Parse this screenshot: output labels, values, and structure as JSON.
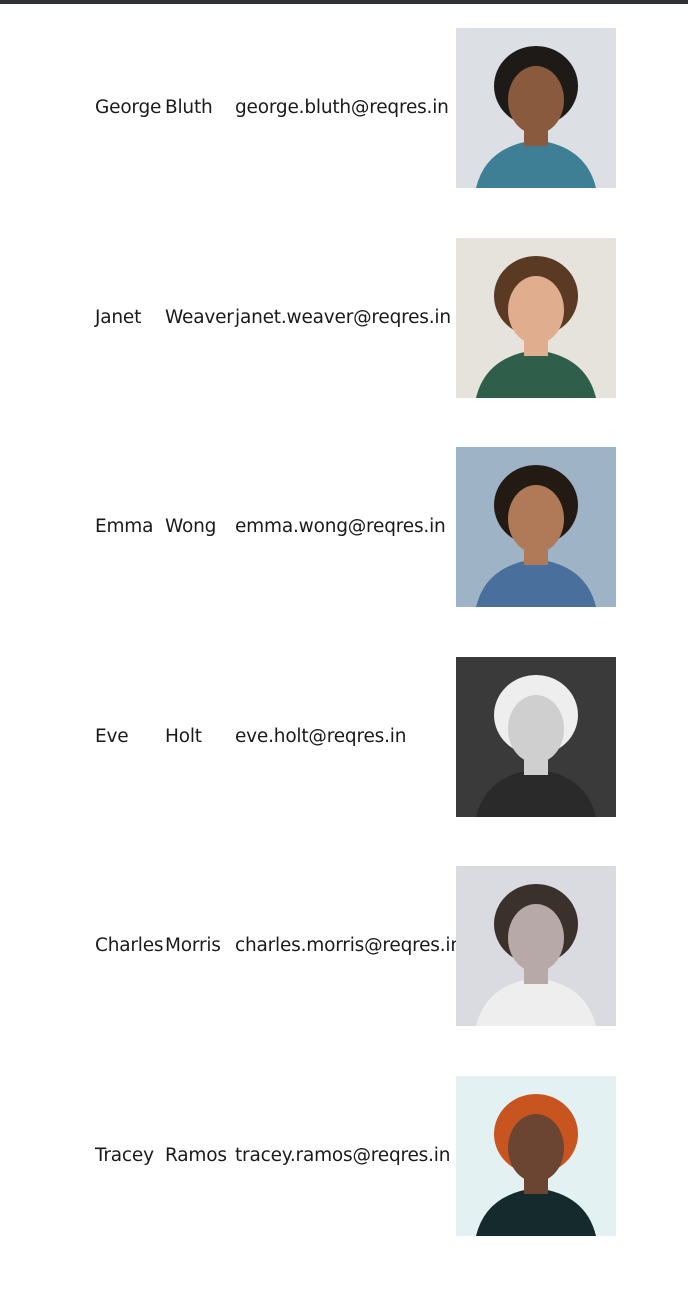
{
  "users": [
    {
      "first_name": "George",
      "last_name": "Bluth",
      "email": "george.bluth@reqres.in",
      "avatar": {
        "bg": "#dcdfe3",
        "skin": "#8a5a3f",
        "hair": "#1e1a17",
        "shirt": "#3f7f95",
        "grayscale": false
      }
    },
    {
      "first_name": "Janet",
      "last_name": "Weaver",
      "email": "janet.weaver@reqres.in",
      "avatar": {
        "bg": "#e6e2dc",
        "skin": "#e0ad8e",
        "hair": "#5b3a24",
        "shirt": "#2f5e4a",
        "grayscale": false
      }
    },
    {
      "first_name": "Emma",
      "last_name": "Wong",
      "email": "emma.wong@reqres.in",
      "avatar": {
        "bg": "#9fb3c6",
        "skin": "#b07a58",
        "hair": "#241a14",
        "shirt": "#496f9d",
        "grayscale": false
      }
    },
    {
      "first_name": "Eve",
      "last_name": "Holt",
      "email": "eve.holt@reqres.in",
      "avatar": {
        "bg": "#3a3a3a",
        "skin": "#cfcfcf",
        "hair": "#eeeeee",
        "shirt": "#2a2a2a",
        "grayscale": true
      }
    },
    {
      "first_name": "Charles",
      "last_name": "Morris",
      "email": "charles.morris@reqres.in",
      "avatar": {
        "bg": "#d9dbe0",
        "skin": "#b6a9a8",
        "hair": "#3a302c",
        "shirt": "#eeeeee",
        "grayscale": false
      }
    },
    {
      "first_name": "Tracey",
      "last_name": "Ramos",
      "email": "tracey.ramos@reqres.in",
      "avatar": {
        "bg": "#e4f1f3",
        "skin": "#6b4532",
        "hair": "#c8551f",
        "shirt": "#142a2c",
        "grayscale": false
      }
    }
  ]
}
